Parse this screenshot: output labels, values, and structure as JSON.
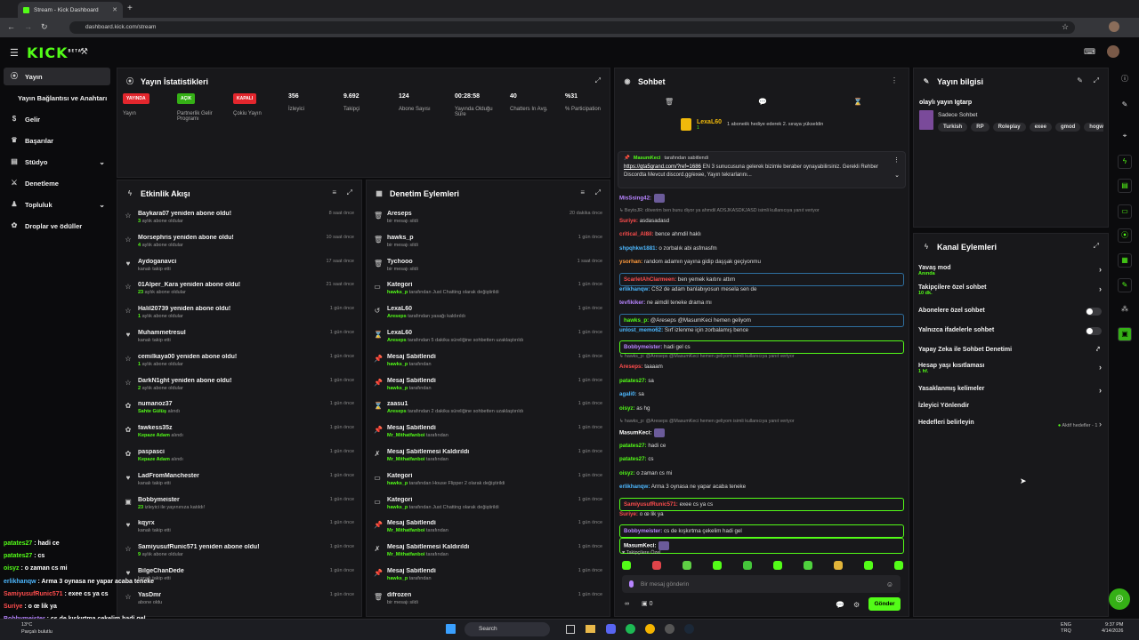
{
  "browser": {
    "tab_title": "Stream - Kick Dashboard",
    "url": "dashboard.kick.com/stream"
  },
  "app": {
    "logo": "KICK",
    "logo_sup": "BETA"
  },
  "sidebar": {
    "items": [
      {
        "label": "Yayın",
        "icon": "broadcast-icon",
        "active": true
      },
      {
        "label": "Yayın Bağlantısı ve Anahtarı"
      },
      {
        "label": "Gelir",
        "icon": "dollar-icon"
      },
      {
        "label": "Başarılar",
        "icon": "trophy-icon"
      },
      {
        "label": "Stüdyo",
        "icon": "layers-icon",
        "chevron": true
      },
      {
        "label": "Denetleme",
        "icon": "sword-icon"
      },
      {
        "label": "Topluluk",
        "icon": "users-icon",
        "chevron": true
      },
      {
        "label": "Droplar ve ödüller",
        "icon": "gift-icon"
      }
    ]
  },
  "stats": {
    "title": "Yayın İstatistikleri",
    "items": [
      {
        "badge": "YAYINDA",
        "color": "#e3262d",
        "label": "Yayın"
      },
      {
        "badge": "AÇIK",
        "color": "#35b016",
        "label": "Partnerlik Gelir Programı"
      },
      {
        "badge": "KAPALI",
        "color": "#e3262d",
        "label": "Çokiu Yayın"
      },
      {
        "value": "356",
        "label": "İzleyici"
      },
      {
        "value": "9.692",
        "label": "Takipçi"
      },
      {
        "value": "124",
        "label": "Abone Sayısı"
      },
      {
        "value": "00:28:58",
        "label": "Yayında Olduğu Süre"
      },
      {
        "value": "40",
        "label": "Chatters In Avg."
      },
      {
        "value": "%31",
        "label": "% Participation"
      }
    ]
  },
  "activity": {
    "title": "Etkinlik Akışı",
    "rows": [
      {
        "icon": "star-icon",
        "name": "Baykara07 yeniden abone oldu!",
        "hl": "3",
        "sub": "aylık abone oldular",
        "time": "8 saat önce"
      },
      {
        "icon": "star-icon",
        "name": "Morsephris yeniden abone oldu!",
        "hl": "4",
        "sub": "aylık abone oldular",
        "time": "10 saat önce"
      },
      {
        "icon": "heart-icon",
        "name": "Aydoganavci",
        "hl": "",
        "sub": "kanalı takip etti",
        "time": "17 saat önce"
      },
      {
        "icon": "star-icon",
        "name": "01Alper_Kara yeniden abone oldu!",
        "hl": "23",
        "sub": "aylık abone oldular",
        "time": "21 saat önce"
      },
      {
        "icon": "star-icon",
        "name": "Halil20739 yeniden abone oldu!",
        "hl": "1",
        "sub": "aylık abone oldular",
        "time": "1 gün önce"
      },
      {
        "icon": "heart-icon",
        "name": "Muhammetresul",
        "hl": "",
        "sub": "kanalı takip etti",
        "time": "1 gün önce"
      },
      {
        "icon": "star-icon",
        "name": "cemilkaya00 yeniden abone oldu!",
        "hl": "1",
        "sub": "aylık abone oldular",
        "time": "1 gün önce"
      },
      {
        "icon": "star-icon",
        "name": "DarkN1ght yeniden abone oldu!",
        "hl": "2",
        "sub": "aylık abone oldular",
        "time": "1 gün önce"
      },
      {
        "icon": "gift-icon",
        "name": "numanoz37",
        "hl": "Sahte Gülüş",
        "sub": "alındı",
        "time": "1 gün önce"
      },
      {
        "icon": "gift-icon",
        "name": "fawkess35z",
        "hl": "Kepaze Adam",
        "sub": "alındı",
        "time": "1 gün önce"
      },
      {
        "icon": "gift-icon",
        "name": "paspasci",
        "hl": "Kepaze Adam",
        "sub": "alındı",
        "time": "1 gün önce"
      },
      {
        "icon": "heart-icon",
        "name": "LadFromManchester",
        "hl": "",
        "sub": "kanalı takip etti",
        "time": "1 gün önce"
      },
      {
        "icon": "host-icon",
        "name": "Bobbymeister",
        "hl": "23",
        "sub": "izleyici ile yayınınıza katıldı!",
        "time": "1 gün önce"
      },
      {
        "icon": "heart-icon",
        "name": "kqyrx",
        "hl": "",
        "sub": "kanalı takip etti",
        "time": "1 gün önce"
      },
      {
        "icon": "star-icon",
        "name": "SamiyusufRunic571 yeniden abone oldu!",
        "hl": "9",
        "sub": "aylık abone oldular",
        "time": "1 gün önce"
      },
      {
        "icon": "heart-icon",
        "name": "BilgeChanDede",
        "hl": "",
        "sub": "kanalı takip etti",
        "time": "1 gün önce"
      },
      {
        "icon": "star-icon",
        "name": "YasDmr",
        "hl": "",
        "sub": "abone oldu",
        "time": "1 gün önce"
      }
    ]
  },
  "moderation": {
    "title": "Denetim Eylemleri",
    "rows": [
      {
        "icon": "trash-icon",
        "name": "Areseps",
        "hl": "",
        "sub": "bir mesajı sildi",
        "time": "20 dakika önce"
      },
      {
        "icon": "trash-icon",
        "name": "hawks_p",
        "hl": "",
        "sub": "bir mesajı sildi",
        "time": "1 gün önce"
      },
      {
        "icon": "trash-icon",
        "name": "Tychooo",
        "hl": "",
        "sub": "bir mesajı sildi",
        "time": "1 saat önce"
      },
      {
        "icon": "tv-icon",
        "name": "Kategori",
        "hl": "hawks_p",
        "sub": "tarafından Just Chatting olarak değiştirildi",
        "time": "1 gün önce"
      },
      {
        "icon": "undo-icon",
        "name": "LexaL60",
        "hl": "Areseps",
        "sub": "tarafından yasağı kaldırıldı",
        "time": "1 gün önce"
      },
      {
        "icon": "hourglass-icon",
        "name": "LexaL60",
        "hl": "Areseps",
        "sub": "tarafından 5 dakika süreliğine sohbetten uzaklaştırıldı",
        "time": "1 gün önce"
      },
      {
        "icon": "pin-icon",
        "name": "Mesaj Sabitlendi",
        "hl": "hawks_p",
        "sub": "tarafından",
        "time": "1 gün önce"
      },
      {
        "icon": "pin-icon",
        "name": "Mesaj Sabitlendi",
        "hl": "hawks_p",
        "sub": "tarafından",
        "time": "1 gün önce"
      },
      {
        "icon": "hourglass-icon",
        "name": "zaasu1",
        "hl": "Areseps",
        "sub": "tarafından 2 dakika süreliğine sohbetten uzaklaştırıldı",
        "time": "1 gün önce"
      },
      {
        "icon": "pin-icon",
        "name": "Mesaj Sabitlendi",
        "hl": "Mr_Mithatfanboi",
        "sub": "tarafından",
        "time": "1 gün önce"
      },
      {
        "icon": "unpin-icon",
        "name": "Mesaj Sabitlemesi Kaldırıldı",
        "hl": "Mr_Mithatfanboi",
        "sub": "tarafından",
        "time": "1 gün önce"
      },
      {
        "icon": "tv-icon",
        "name": "Kategori",
        "hl": "hawks_p",
        "sub": "tarafından House Flipper 2 olarak değiştirildi",
        "time": "1 gün önce"
      },
      {
        "icon": "tv-icon",
        "name": "Kategori",
        "hl": "hawks_p",
        "sub": "tarafından Just Chatting olarak değiştirildi",
        "time": "1 gün önce"
      },
      {
        "icon": "pin-icon",
        "name": "Mesaj Sabitlendi",
        "hl": "Mr_Mithatfanboi",
        "sub": "tarafından",
        "time": "1 gün önce"
      },
      {
        "icon": "unpin-icon",
        "name": "Mesaj Sabitlemesi Kaldırıldı",
        "hl": "Mr_Mithatfanboi",
        "sub": "tarafından",
        "time": "1 gün önce"
      },
      {
        "icon": "pin-icon",
        "name": "Mesaj Sabitlendi",
        "hl": "hawks_p",
        "sub": "tarafından",
        "time": "1 gün önce"
      },
      {
        "icon": "trash-icon",
        "name": "difrozen",
        "hl": "",
        "sub": "bir mesajı sildi",
        "time": "1 gün önce"
      }
    ]
  },
  "chat": {
    "title": "Sohbet",
    "gift": {
      "user": "LexaL60",
      "count": "1",
      "text": "1 aboneiik hediye ederek 2. sıraya yükseldin"
    },
    "pinned": {
      "by": "MasumKeci",
      "by_suffix": "tarafından sabitlendi",
      "link": "https://gta5grand.com/?ref=1686",
      "text": " EN 3 sunucusuna gelerek bizimle beraber oynayabilirsiniz. Gerekli Rehber Discordta Mevcut discord.gg/exee, Yayın tekrarlarını..."
    },
    "messages": [
      {
        "user": "MisSsing42:",
        "color": "#b784ff",
        "text": "",
        "emote": true
      },
      {
        "reply": "BeytoJR: döverim ben bunu diyor ya ahmdil ADSJKASDKJASD isimli kullanıcıya yanıt veriyor"
      },
      {
        "user": "Suriye:",
        "color": "#ff4d4d",
        "text": " asdasadasd"
      },
      {
        "user": "critical_AI8il:",
        "color": "#ff4d4d",
        "text": " bence ahmdil haklı"
      },
      {
        "user": "shpqhkw1881:",
        "color": "#4db8ff",
        "text": " o zorbalık abi asfmasfm"
      },
      {
        "user": "ysorhan:",
        "color": "#ff9a3c",
        "text": " random adamın yayına gidip daşşak geçiyonmu"
      },
      {
        "user": "ScarletAhClarmeen:",
        "color": "#ff4d4d",
        "text": " ben yemek kaıtını attım",
        "box": "ch"
      },
      {
        "user": "erlikhanqw:",
        "color": "#4db8ff",
        "text": " CS2 de adam banlabıyosun mesela sen de"
      },
      {
        "user": "tevfikiker:",
        "color": "#b784ff",
        "text": " ne aimdil teneke drama mı"
      },
      {
        "user": "hawks_p:",
        "color": "#53fc18",
        "text": " @Areseps @MasumKeci hemen geliyom",
        "box": "ch"
      },
      {
        "user": "unlost_memo62:",
        "color": "#4db8ff",
        "text": " Sırf izlenme için zorbalamış bence"
      },
      {
        "user": "Bobbymeister:",
        "color": "#b784ff",
        "text": " hadi gel cs",
        "box": "green"
      },
      {
        "reply": "hawks_p: @Areseps @MasumKeci hemen geliyom isimli kullanıcıya yanıt veriyor"
      },
      {
        "user": "Areseps:",
        "color": "#ff4d4d",
        "text": " taaaam"
      },
      {
        "user": "patates27:",
        "color": "#53fc18",
        "text": " sa"
      },
      {
        "user": "agali0:",
        "color": "#4db8ff",
        "text": " sa"
      },
      {
        "user": "oisyz:",
        "color": "#53fc18",
        "text": " as hg"
      },
      {
        "reply": "hawks_p: @Areseps @MasumKeci hemen geliyom isimli kullanıcıya yanıt veriyor"
      },
      {
        "user": "MasumKeci:",
        "color": "#ffffff",
        "text": "",
        "emote": true
      },
      {
        "user": "patates27:",
        "color": "#53fc18",
        "text": " hadi ce"
      },
      {
        "user": "patates27:",
        "color": "#53fc18",
        "text": " cs"
      },
      {
        "user": "oisyz:",
        "color": "#53fc18",
        "text": " o zaman cs mi"
      },
      {
        "user": "erlikhanqw:",
        "color": "#4db8ff",
        "text": " Arma 3 oynasa ne yapar acaba teneke"
      },
      {
        "user": "SamiyusufRunic571:",
        "color": "#ff4d4d",
        "text": " exee cs ya cs",
        "box": "green"
      },
      {
        "user": "Suriye:",
        "color": "#ff4d4d",
        "text": " o œ lik ya"
      },
      {
        "user": "Bobbymeister:",
        "color": "#b784ff",
        "text": " cs de kışkırtma çekelim hadi gel",
        "box": "green"
      },
      {
        "user": "MasumKeci:",
        "color": "#ffffff",
        "text": "",
        "emote": true,
        "box": "green"
      }
    ],
    "followers_label": "Takipçilere Özel",
    "input_placeholder": "Bir mesaj gönderin",
    "send_label": "Gönder",
    "counter1": "∞",
    "counter2": "0"
  },
  "info": {
    "title": "Yayın bilgisi",
    "stream_title": "olaylı yayın Igtarp",
    "category": "Sadece Sohbet",
    "tags": [
      "Turkish",
      "RP",
      "Roleplay",
      "exee",
      "gmod",
      "hogwar"
    ]
  },
  "channel_actions": {
    "title": "Kanal Eylemleri",
    "items": [
      {
        "label": "Yavaş mod",
        "sub": "Anında",
        "type": "chevron"
      },
      {
        "label": "Takipçilere özel sohbet",
        "sub": "10 dk.",
        "type": "chevron"
      },
      {
        "label": "Abonelere özel sohbet",
        "sub": "",
        "type": "toggle"
      },
      {
        "label": "Yalnızca ifadelerle sohbet",
        "sub": "",
        "type": "toggle"
      },
      {
        "label": "Yapay Zeka ile Sohbet Denetimi",
        "sub": "",
        "type": "ext"
      },
      {
        "label": "Hesap yaşı kısıtlaması",
        "sub": "1 hf.",
        "type": "chevron"
      },
      {
        "label": "Yasaklanmış kelimeler",
        "sub": "",
        "type": "chevron"
      },
      {
        "label": "İzleyici Yönlendir",
        "sub": "",
        "type": "none"
      },
      {
        "label": "Hedefleri belirleyin",
        "sub": "",
        "type": "goal",
        "extra": "Aktif hedefler - 1"
      }
    ]
  },
  "overlay_chat": [
    {
      "user": "patates27",
      "color": "#53fc18",
      "text": " : hadi ce"
    },
    {
      "user": "patates27",
      "color": "#53fc18",
      "text": " : cs"
    },
    {
      "user": "oisyz",
      "color": "#53fc18",
      "text": " : o zaman cs mi"
    },
    {
      "user": "erlikhanqw",
      "color": "#4db8ff",
      "text": " : Arma 3 oynasa ne yapar acaba teneke"
    },
    {
      "user": "SamiyusufRunic571",
      "color": "#ff4d4d",
      "text": " : exee cs ya cs"
    },
    {
      "user": "Suriye",
      "color": "#ff4d4d",
      "text": " : o œ lik ya"
    },
    {
      "user": "Bobbymeister",
      "color": "#b784ff",
      "text": " : cs de kışkırtma çekelim hadi gel"
    }
  ],
  "taskbar": {
    "weather_temp": "13°C",
    "weather_text": "Parçalı bulutlu",
    "search": "Search",
    "lang1": "ENG",
    "lang2": "TRQ",
    "time": "9:37 PM",
    "date": "4/14/2026"
  },
  "colors": {
    "accent": "#53fc18",
    "panel": "#18181b",
    "bg": "#0b0b0d"
  }
}
